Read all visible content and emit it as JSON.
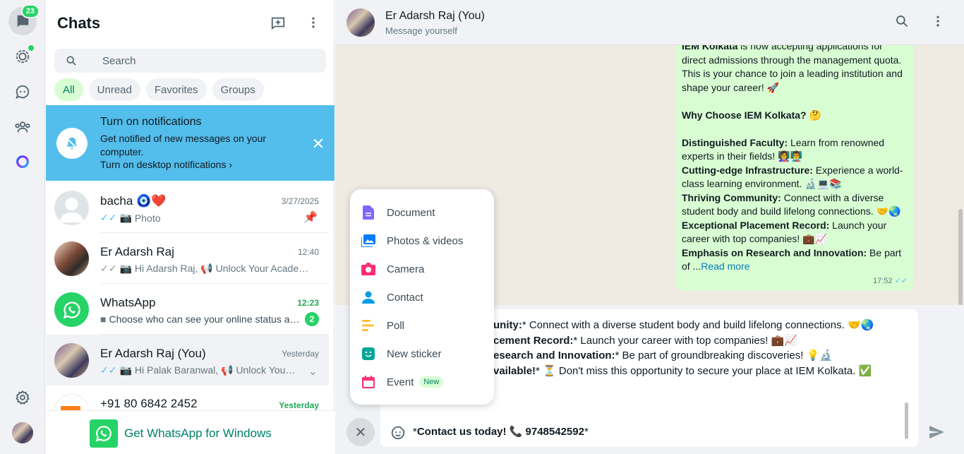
{
  "rail": {
    "chats_badge": "23"
  },
  "panel": {
    "title": "Chats",
    "search_placeholder": "Search",
    "filters": [
      "All",
      "Unread",
      "Favorites",
      "Groups"
    ]
  },
  "notification": {
    "title": "Turn on notifications",
    "body": "Get notified of new messages on your computer.",
    "link": "Turn on desktop notifications"
  },
  "chats": [
    {
      "name": "bacha 🧿❤️",
      "time": "3/27/2025",
      "preview": "Photo",
      "icon": "camera-icon",
      "pinned": true
    },
    {
      "name": "Er Adarsh Raj",
      "time": "12:40",
      "preview": "Hi Adarsh Raj, 📢 Unlock Your Academic Potential at IEM Kolkata!",
      "icon": "camera-icon"
    },
    {
      "name": "WhatsApp",
      "time": "12:23",
      "preview": "Choose who can see your online status and when you're online",
      "icon": "video-icon",
      "unread": "2"
    },
    {
      "name": "Er Adarsh Raj (You)",
      "time": "Yesterday",
      "preview": "Hi Palak Baranwal, 📢 Unlock Your Academic Potential",
      "icon": "camera-icon"
    },
    {
      "name": "+91 80 6842 2452",
      "time": "Yesterday"
    }
  ],
  "get_app": "Get WhatsApp for Windows",
  "conversation": {
    "title": "Er Adarsh Raj (You)",
    "subtitle": "Message yourself",
    "message": {
      "l1a": "IEM Kolkata",
      "l1b": " is now accepting applications for",
      "l2": "direct admissions through the management quota.",
      "l3": "This is your chance to join a leading institution and",
      "l4": "shape your career! 🚀",
      "why": "Why Choose IEM Kolkata? 🤔",
      "f1_h": "Distinguished Faculty:",
      "f1_t": " Learn from renowned experts in their fields! 👩‍🏫👨‍🏫",
      "f2_h": "Cutting-edge Infrastructure:",
      "f2_t": " Experience a world-class learning environment. 🔬💻📚",
      "f3_h": "Thriving Community:",
      "f3_t": " Connect with a diverse student body and build lifelong connections. 🤝🌏",
      "f4_h": "Exceptional Placement Record:",
      "f4_t": " Launch your career with top companies! 💼📈",
      "f5_h": "Emphasis on Research and Innovation:",
      "f5_t": " Be part of ...",
      "read_more": "Read more",
      "time": "17:52"
    },
    "composer": {
      "line1_b": "unity:",
      "line1_t": "* Connect with a diverse student body and build lifelong connections. 🤝🌏",
      "line2_b": "cement Record:",
      "line2_t": "* Launch your career with top companies! 💼📈",
      "line3_b": "esearch and Innovation:",
      "line3_t": "* Be part of groundbreaking discoveries! 💡🔬",
      "line4_b": "vailable!",
      "line4_t": "* ⏳ Don't miss this opportunity to secure your place at IEM Kolkata. ✅",
      "bottom_a": "*",
      "bottom_b": "Contact us today! 📞 9748542592",
      "bottom_c": "*"
    }
  },
  "attach_menu": {
    "items": [
      {
        "label": "Document",
        "color": "#7f66ff"
      },
      {
        "label": "Photos & videos",
        "color": "#007bfc"
      },
      {
        "label": "Camera",
        "color": "#ff2e74"
      },
      {
        "label": "Contact",
        "color": "#009de2"
      },
      {
        "label": "Poll",
        "color": "#ffbc38"
      },
      {
        "label": "New sticker",
        "color": "#02a698"
      },
      {
        "label": "Event",
        "color": "#ff2e74"
      }
    ],
    "new_tag": "New"
  },
  "colors": {
    "accent": "#25d366",
    "notification_bg": "#53bdeb",
    "bubble_out": "#d9fdd3"
  }
}
